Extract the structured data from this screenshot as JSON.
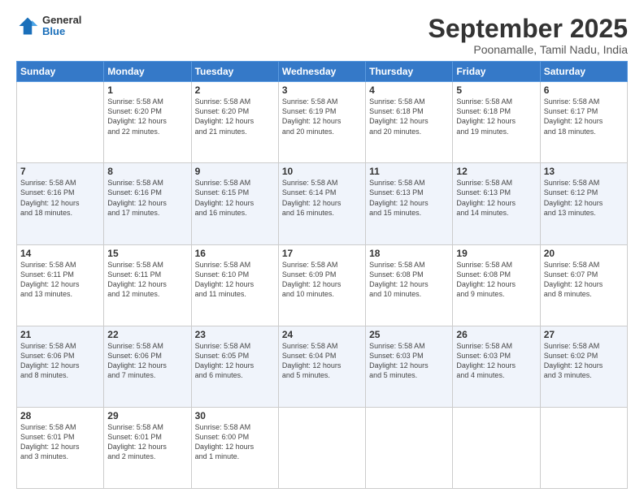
{
  "header": {
    "logo_general": "General",
    "logo_blue": "Blue",
    "title": "September 2025",
    "subtitle": "Poonamalle, Tamil Nadu, India"
  },
  "days_of_week": [
    "Sunday",
    "Monday",
    "Tuesday",
    "Wednesday",
    "Thursday",
    "Friday",
    "Saturday"
  ],
  "weeks": [
    [
      {
        "day": "",
        "info": ""
      },
      {
        "day": "1",
        "info": "Sunrise: 5:58 AM\nSunset: 6:20 PM\nDaylight: 12 hours\nand 22 minutes."
      },
      {
        "day": "2",
        "info": "Sunrise: 5:58 AM\nSunset: 6:20 PM\nDaylight: 12 hours\nand 21 minutes."
      },
      {
        "day": "3",
        "info": "Sunrise: 5:58 AM\nSunset: 6:19 PM\nDaylight: 12 hours\nand 20 minutes."
      },
      {
        "day": "4",
        "info": "Sunrise: 5:58 AM\nSunset: 6:18 PM\nDaylight: 12 hours\nand 20 minutes."
      },
      {
        "day": "5",
        "info": "Sunrise: 5:58 AM\nSunset: 6:18 PM\nDaylight: 12 hours\nand 19 minutes."
      },
      {
        "day": "6",
        "info": "Sunrise: 5:58 AM\nSunset: 6:17 PM\nDaylight: 12 hours\nand 18 minutes."
      }
    ],
    [
      {
        "day": "7",
        "info": "Sunrise: 5:58 AM\nSunset: 6:16 PM\nDaylight: 12 hours\nand 18 minutes."
      },
      {
        "day": "8",
        "info": "Sunrise: 5:58 AM\nSunset: 6:16 PM\nDaylight: 12 hours\nand 17 minutes."
      },
      {
        "day": "9",
        "info": "Sunrise: 5:58 AM\nSunset: 6:15 PM\nDaylight: 12 hours\nand 16 minutes."
      },
      {
        "day": "10",
        "info": "Sunrise: 5:58 AM\nSunset: 6:14 PM\nDaylight: 12 hours\nand 16 minutes."
      },
      {
        "day": "11",
        "info": "Sunrise: 5:58 AM\nSunset: 6:13 PM\nDaylight: 12 hours\nand 15 minutes."
      },
      {
        "day": "12",
        "info": "Sunrise: 5:58 AM\nSunset: 6:13 PM\nDaylight: 12 hours\nand 14 minutes."
      },
      {
        "day": "13",
        "info": "Sunrise: 5:58 AM\nSunset: 6:12 PM\nDaylight: 12 hours\nand 13 minutes."
      }
    ],
    [
      {
        "day": "14",
        "info": "Sunrise: 5:58 AM\nSunset: 6:11 PM\nDaylight: 12 hours\nand 13 minutes."
      },
      {
        "day": "15",
        "info": "Sunrise: 5:58 AM\nSunset: 6:11 PM\nDaylight: 12 hours\nand 12 minutes."
      },
      {
        "day": "16",
        "info": "Sunrise: 5:58 AM\nSunset: 6:10 PM\nDaylight: 12 hours\nand 11 minutes."
      },
      {
        "day": "17",
        "info": "Sunrise: 5:58 AM\nSunset: 6:09 PM\nDaylight: 12 hours\nand 10 minutes."
      },
      {
        "day": "18",
        "info": "Sunrise: 5:58 AM\nSunset: 6:08 PM\nDaylight: 12 hours\nand 10 minutes."
      },
      {
        "day": "19",
        "info": "Sunrise: 5:58 AM\nSunset: 6:08 PM\nDaylight: 12 hours\nand 9 minutes."
      },
      {
        "day": "20",
        "info": "Sunrise: 5:58 AM\nSunset: 6:07 PM\nDaylight: 12 hours\nand 8 minutes."
      }
    ],
    [
      {
        "day": "21",
        "info": "Sunrise: 5:58 AM\nSunset: 6:06 PM\nDaylight: 12 hours\nand 8 minutes."
      },
      {
        "day": "22",
        "info": "Sunrise: 5:58 AM\nSunset: 6:06 PM\nDaylight: 12 hours\nand 7 minutes."
      },
      {
        "day": "23",
        "info": "Sunrise: 5:58 AM\nSunset: 6:05 PM\nDaylight: 12 hours\nand 6 minutes."
      },
      {
        "day": "24",
        "info": "Sunrise: 5:58 AM\nSunset: 6:04 PM\nDaylight: 12 hours\nand 5 minutes."
      },
      {
        "day": "25",
        "info": "Sunrise: 5:58 AM\nSunset: 6:03 PM\nDaylight: 12 hours\nand 5 minutes."
      },
      {
        "day": "26",
        "info": "Sunrise: 5:58 AM\nSunset: 6:03 PM\nDaylight: 12 hours\nand 4 minutes."
      },
      {
        "day": "27",
        "info": "Sunrise: 5:58 AM\nSunset: 6:02 PM\nDaylight: 12 hours\nand 3 minutes."
      }
    ],
    [
      {
        "day": "28",
        "info": "Sunrise: 5:58 AM\nSunset: 6:01 PM\nDaylight: 12 hours\nand 3 minutes."
      },
      {
        "day": "29",
        "info": "Sunrise: 5:58 AM\nSunset: 6:01 PM\nDaylight: 12 hours\nand 2 minutes."
      },
      {
        "day": "30",
        "info": "Sunrise: 5:58 AM\nSunset: 6:00 PM\nDaylight: 12 hours\nand 1 minute."
      },
      {
        "day": "",
        "info": ""
      },
      {
        "day": "",
        "info": ""
      },
      {
        "day": "",
        "info": ""
      },
      {
        "day": "",
        "info": ""
      }
    ]
  ]
}
